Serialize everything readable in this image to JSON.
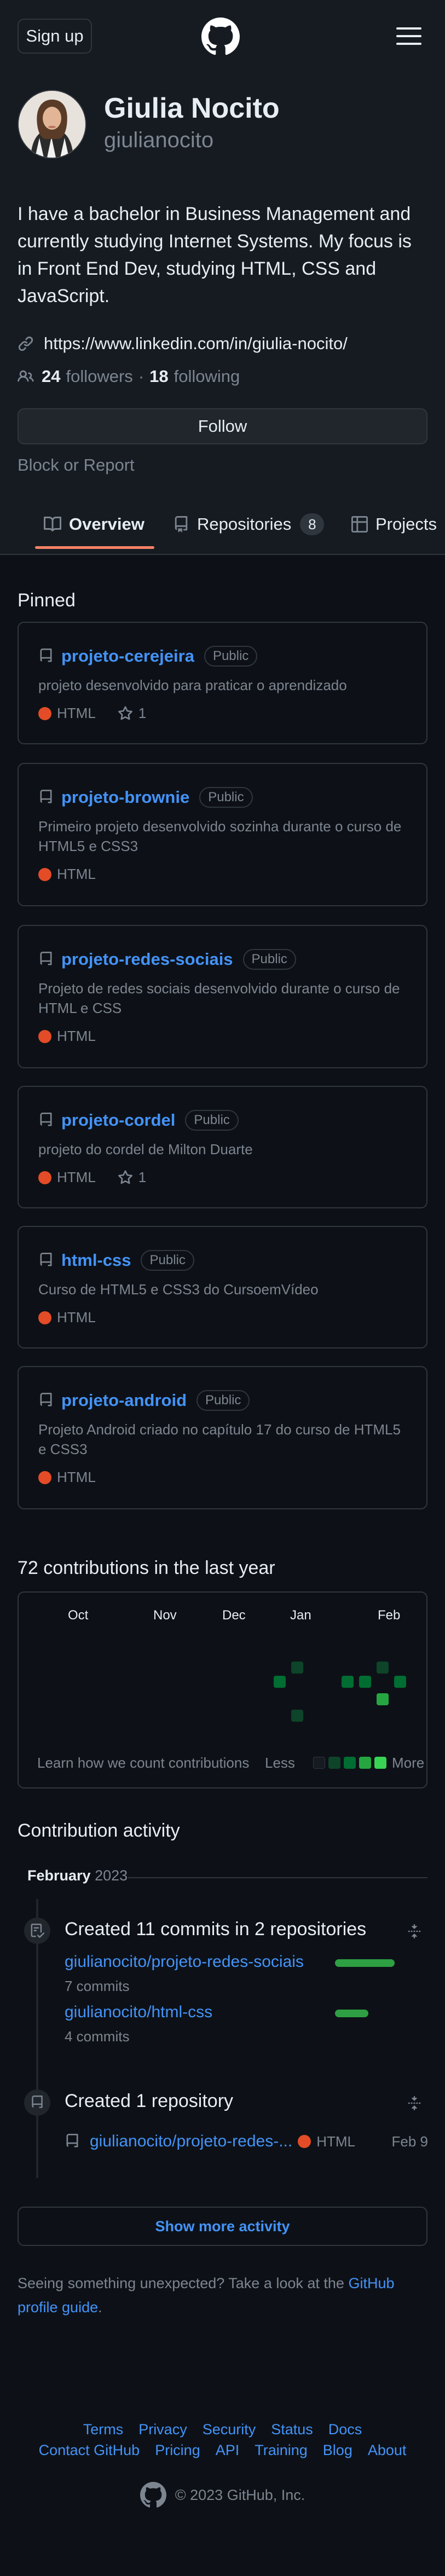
{
  "header": {
    "signup_label": "Sign up"
  },
  "profile": {
    "full_name": "Giulia Nocito",
    "username": "giulianocito",
    "bio": "I have a bachelor in Business Management and currently studying Internet Systems. My focus is in Front End Dev, studying HTML, CSS and JavaScript.",
    "website": "https://www.linkedin.com/in/giulia-nocito/",
    "followers_count": "24",
    "followers_label": "followers",
    "separator": "·",
    "following_count": "18",
    "following_label": "following",
    "follow_label": "Follow",
    "block_report_label": "Block or Report"
  },
  "tabs": [
    {
      "label": "Overview",
      "selected": true
    },
    {
      "label": "Repositories",
      "counter": "8"
    },
    {
      "label": "Projects"
    }
  ],
  "pinned": {
    "title": "Pinned",
    "items": [
      {
        "name": "projeto-cerejeira",
        "visibility": "Public",
        "description": "projeto desenvolvido para praticar o aprendizado",
        "language": "HTML",
        "stars": "1"
      },
      {
        "name": "projeto-brownie",
        "visibility": "Public",
        "description": "Primeiro projeto desenvolvido sozinha durante o curso de HTML5 e CSS3",
        "language": "HTML"
      },
      {
        "name": "projeto-redes-sociais",
        "visibility": "Public",
        "description": "Projeto de redes sociais desenvolvido durante o curso de HTML e CSS",
        "language": "HTML"
      },
      {
        "name": "projeto-cordel",
        "visibility": "Public",
        "description": "projeto do cordel de Milton Duarte",
        "language": "HTML",
        "stars": "1"
      },
      {
        "name": "html-css",
        "visibility": "Public",
        "description": "Curso de HTML5 e CSS3 do CursoemVídeo",
        "language": "HTML"
      },
      {
        "name": "projeto-android",
        "visibility": "Public",
        "description": "Projeto Android criado no capítulo 17 do curso de HTML5 e CSS3",
        "language": "HTML"
      }
    ]
  },
  "colors": {
    "accent": "#4493f8",
    "html_language": "#e34c26",
    "tab_underline": "#f78166",
    "contrib_green": "#2ea043"
  },
  "contributions": {
    "title": "72 contributions in the last year",
    "months": [
      "Oct",
      "Nov",
      "Dec",
      "Jan",
      "Feb"
    ],
    "learn_label": "Learn how we count contributions",
    "less_label": "Less",
    "more_label": "More"
  },
  "activity": {
    "title": "Contribution activity",
    "month": "February",
    "year": "2023",
    "commits_title": "Created 11 commits in 2 repositories",
    "commit_repos": [
      {
        "name": "giulianocito/projeto-redes-sociais",
        "commits": "7 commits",
        "share": 0.64
      },
      {
        "name": "giulianocito/html-css",
        "commits": "4 commits",
        "share": 0.36
      }
    ],
    "repo_title": "Created 1 repository",
    "created_repo": {
      "name": "giulianocito/projeto-redes-...",
      "language": "HTML",
      "date": "Feb 9"
    },
    "show_more_label": "Show more activity",
    "hint_text": "Seeing something unexpected? Take a look at the",
    "hint_link": "GitHub profile guide",
    "hint_end": "."
  },
  "footer": {
    "row1": [
      "Terms",
      "Privacy",
      "Security",
      "Status",
      "Docs"
    ],
    "row2": [
      "Contact GitHub",
      "Pricing",
      "API",
      "Training",
      "Blog",
      "About"
    ],
    "copyright": "© 2023 GitHub, Inc."
  }
}
